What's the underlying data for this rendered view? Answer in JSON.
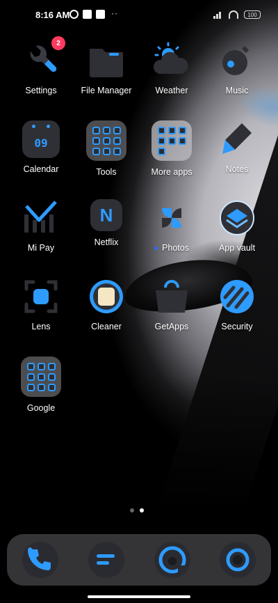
{
  "status_bar": {
    "time": "8:16 AM",
    "overflow": "··",
    "battery": "100"
  },
  "apps": [
    {
      "label": "Settings",
      "icon": "wrench-icon",
      "badge": "2"
    },
    {
      "label": "File Manager",
      "icon": "folder-icon"
    },
    {
      "label": "Weather",
      "icon": "weather-icon"
    },
    {
      "label": "Music",
      "icon": "music-icon"
    },
    {
      "label": "Calendar",
      "icon": "calendar-icon",
      "date": "09"
    },
    {
      "label": "Tools",
      "icon": "tools-folder-icon"
    },
    {
      "label": "More apps",
      "icon": "more-apps-folder-icon"
    },
    {
      "label": "Notes",
      "icon": "pencil-icon"
    },
    {
      "label": "Mi Pay",
      "icon": "mi-pay-icon"
    },
    {
      "label": "Netflix",
      "icon": "netflix-icon",
      "letter": "N"
    },
    {
      "label": "Photos",
      "icon": "photos-icon"
    },
    {
      "label": "App vault",
      "icon": "app-vault-icon"
    },
    {
      "label": "Lens",
      "icon": "lens-icon"
    },
    {
      "label": "Cleaner",
      "icon": "cleaner-icon"
    },
    {
      "label": "GetApps",
      "icon": "getapps-icon"
    },
    {
      "label": "Security",
      "icon": "security-icon"
    },
    {
      "label": "Google",
      "icon": "google-folder-icon"
    }
  ],
  "dock": [
    {
      "icon": "phone-icon"
    },
    {
      "icon": "messages-icon"
    },
    {
      "icon": "browser-icon"
    },
    {
      "icon": "camera-icon"
    }
  ],
  "colors": {
    "accent": "#2e9bff",
    "badge": "#ff3b60"
  }
}
